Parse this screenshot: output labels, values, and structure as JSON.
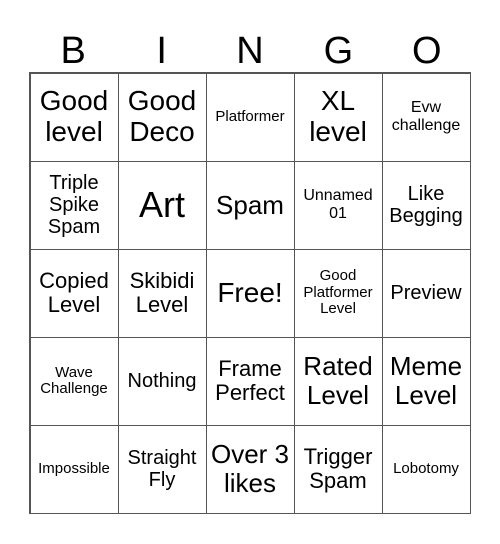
{
  "header": [
    "B",
    "I",
    "N",
    "G",
    "O"
  ],
  "cells": [
    [
      "Good level",
      "Good Deco",
      "Platformer",
      "XL level",
      "Evw challenge"
    ],
    [
      "Triple Spike Spam",
      "Art",
      "Spam",
      "Unnamed 01",
      "Like Begging"
    ],
    [
      "Copied Level",
      "Skibidi Level",
      "Free!",
      "Good Platformer Level",
      "Preview"
    ],
    [
      "Wave Challenge",
      "Nothing",
      "Frame Perfect",
      "Rated Level",
      "Meme Level"
    ],
    [
      "Impossible",
      "Straight Fly",
      "Over 3 likes",
      "Trigger Spam",
      "Lobotomy"
    ]
  ]
}
